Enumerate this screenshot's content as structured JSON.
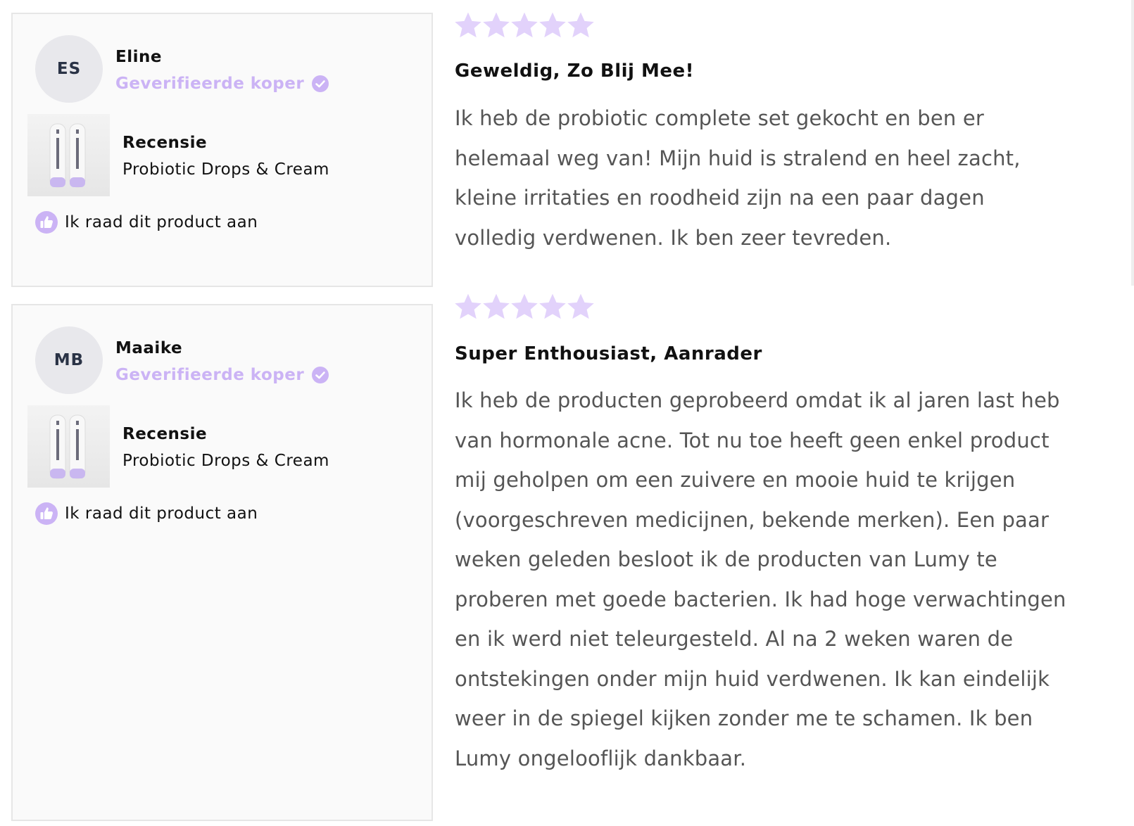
{
  "colors": {
    "accent": "#cbb3f5",
    "star": "#e2d2fb",
    "card_bg": "#fafafa",
    "card_border": "#e6e6e6"
  },
  "reviews": [
    {
      "initials": "ES",
      "name": "Eline",
      "verified_label": "Geverifieerde koper",
      "recensie_label": "Recensie",
      "product": "Probiotic Drops & Cream",
      "recommend_label": "Ik raad dit product aan",
      "rating": 5,
      "title": "Geweldig, Zo Blij Mee!",
      "body": "Ik heb de probiotic complete set gekocht en ben er helemaal weg van! Mijn huid is stralend en heel zacht, kleine irritaties en roodheid zijn na een paar dagen volledig verdwenen. Ik ben zeer tevreden."
    },
    {
      "initials": "MB",
      "name": "Maaike",
      "verified_label": "Geverifieerde koper",
      "recensie_label": "Recensie",
      "product": "Probiotic Drops & Cream",
      "recommend_label": "Ik raad dit product aan",
      "rating": 5,
      "title": "Super Enthousiast, Aanrader",
      "body": "Ik heb de producten geprobeerd omdat ik al jaren last heb van hormonale acne. Tot nu toe heeft geen enkel product mij geholpen om een zuivere en mooie huid te krijgen (voorgeschreven medicijnen, bekende merken). Een paar weken geleden besloot ik de producten van Lumy te proberen met goede bacterien. Ik had hoge verwachtingen en ik werd niet teleurgesteld. Al na 2 weken waren de ontstekingen onder mijn huid verdwenen. Ik kan eindelijk weer in de spiegel kijken zonder me te schamen. Ik ben Lumy ongelooflijk dankbaar."
    }
  ]
}
